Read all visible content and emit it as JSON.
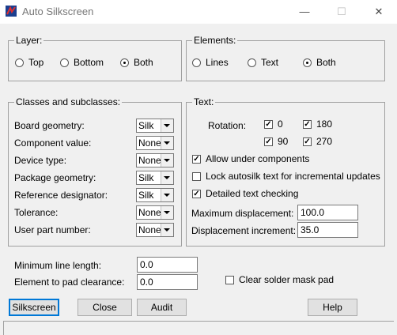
{
  "window": {
    "title": "Auto Silkscreen",
    "minimize": "—",
    "maximize": "☐",
    "close": "✕"
  },
  "layer": {
    "legend": "Layer:",
    "options": [
      "Top",
      "Bottom",
      "Both"
    ],
    "selected": "Both"
  },
  "elements": {
    "legend": "Elements:",
    "options": [
      "Lines",
      "Text",
      "Both"
    ],
    "selected": "Both"
  },
  "classes": {
    "legend": "Classes and subclasses:",
    "rows": [
      {
        "label": "Board geometry:",
        "value": "Silk"
      },
      {
        "label": "Component value:",
        "value": "None"
      },
      {
        "label": "Device type:",
        "value": "None"
      },
      {
        "label": "Package geometry:",
        "value": "Silk"
      },
      {
        "label": "Reference designator:",
        "value": "Silk"
      },
      {
        "label": "Tolerance:",
        "value": "None"
      },
      {
        "label": "User part number:",
        "value": "None"
      }
    ]
  },
  "text": {
    "legend": "Text:",
    "rotation_label": "Rotation:",
    "rotations": [
      {
        "label": "0",
        "checked": true
      },
      {
        "label": "180",
        "checked": true
      },
      {
        "label": "90",
        "checked": true
      },
      {
        "label": "270",
        "checked": true
      }
    ],
    "allow_under_components": {
      "label": "Allow under components",
      "checked": true
    },
    "lock_autosilk": {
      "label": "Lock autosilk text for incremental updates",
      "checked": false
    },
    "detailed_checking": {
      "label": "Detailed text checking",
      "checked": true
    },
    "max_displacement": {
      "label": "Maximum displacement:",
      "value": "100.0"
    },
    "displacement_increment": {
      "label": "Displacement increment:",
      "value": "35.0"
    }
  },
  "min_line_length": {
    "label": "Minimum line length:",
    "value": "0.0"
  },
  "element_to_pad": {
    "label": "Element to pad clearance:",
    "value": "0.0"
  },
  "clear_solder_mask": {
    "label": "Clear solder mask pad",
    "checked": false
  },
  "buttons": {
    "silkscreen": "Silkscreen",
    "close": "Close",
    "audit": "Audit",
    "help": "Help"
  }
}
